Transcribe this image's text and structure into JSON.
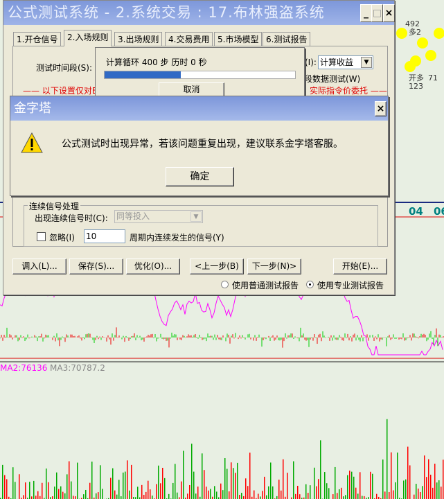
{
  "window": {
    "title": "公式测试系统 - 2.系统交易 : 17.布林强盗系统",
    "minimize": "_",
    "maximize": "□",
    "close": "×"
  },
  "tabs": [
    {
      "label": "1.开仓信号"
    },
    {
      "label": "2.入场规则"
    },
    {
      "label": "3.出场规则"
    },
    {
      "label": "4.交易费用"
    },
    {
      "label": "5.市场模型"
    },
    {
      "label": "6.测试报告"
    }
  ],
  "panel": {
    "test_period_label": "测试时间段(S):",
    "calc_label": "(I):",
    "calc_value": "计算收益",
    "segment_test": "段数据测试(W)",
    "note_left": "—— 以下设置仅对E",
    "note_right": "实际指令价委托 ——"
  },
  "progress": {
    "text": "计算循环 400 步 历时 0 秒",
    "value": 0.4,
    "cancel": "取消"
  },
  "msgbox": {
    "title": "金字塔",
    "close": "×",
    "message": "公式测试时出现异常，若该问题重复出现，建议联系金字塔客服。",
    "ok": "确定"
  },
  "group": {
    "title": "连续信号处理",
    "signal_label": "出现连续信号时(C):",
    "signal_value": "同等投入",
    "ignore_label": "忽略(I)",
    "ignore_value": "10",
    "period_label": "周期内连续发生的信号(Y)"
  },
  "buttons": {
    "load": "调入(L)...",
    "save": "保存(S)...",
    "optimize": "优化(O)...",
    "prev": "<上一步(B)",
    "next": "下一步(N)>",
    "start": "开始(E)..."
  },
  "radios": {
    "normal": "使用普通测试报告",
    "pro": "使用专业测试报告"
  },
  "chart": {
    "axis_labels": [
      "04",
      "06"
    ],
    "ma2": "MA2:76136",
    "ma3": "MA3:70787.2",
    "side_labels": [
      "492",
      "多2",
      "开多",
      "123",
      "71"
    ]
  },
  "colors": {
    "title_bar": "#7d97da",
    "progress": "#316ac5",
    "ma2": "#ff00ff",
    "ma3": "#888888"
  }
}
